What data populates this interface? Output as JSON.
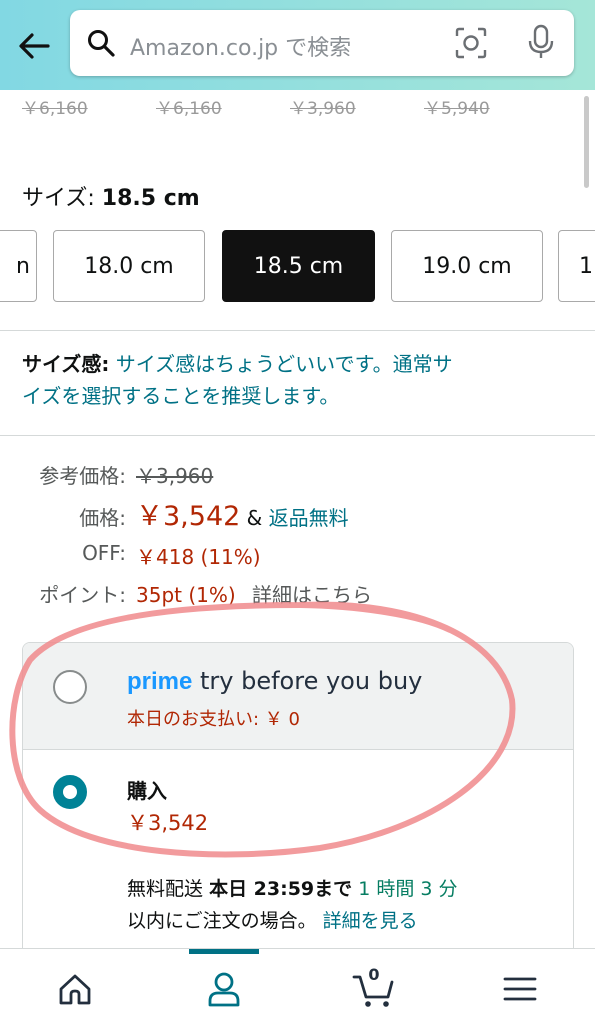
{
  "header": {
    "search_placeholder": "Amazon.co.jp で検索"
  },
  "prev_prices": [
    "￥6,160",
    "￥6,160",
    "￥3,960",
    "￥5,940"
  ],
  "size": {
    "label": "サイズ:",
    "selected": "18.5 cm",
    "options": [
      "n",
      "18.0 cm",
      "18.5 cm",
      "19.0 cm",
      "1"
    ]
  },
  "fit": {
    "label": "サイズ感:",
    "text_line1": "サイズ感はちょうどいいです。通常サ",
    "text_line2": "イズを選択することを推奨します。"
  },
  "pricing": {
    "ref_label": "参考価格:",
    "ref_value": "￥3,960",
    "price_label": "価格:",
    "price_value": "￥3,542",
    "amp": "&",
    "free_returns": "返品無料",
    "off_label": "OFF:",
    "off_value": "￥418 (11%)",
    "points_label": "ポイント:",
    "points_value": "35pt (1%)",
    "points_link": "詳細はこちら"
  },
  "purchase_options": {
    "prime_word": "prime",
    "try_text": "try before you buy",
    "pay_today": "本日のお支払い: ￥ 0",
    "buy_title": "購入",
    "buy_price": "￥3,542",
    "ship_prefix": "無料配送",
    "ship_bold": "本日 23:59まで",
    "ship_time": "1 時間 3 分",
    "ship_line2": "以内にご注文の場合。",
    "ship_link": "詳細を見る"
  },
  "bottom_nav": {
    "cart_count": "0"
  },
  "colors": {
    "accent_teal": "#007185",
    "price_red": "#b12704",
    "header_start": "#82d8e3",
    "annotation_circle": "#f0898c"
  }
}
